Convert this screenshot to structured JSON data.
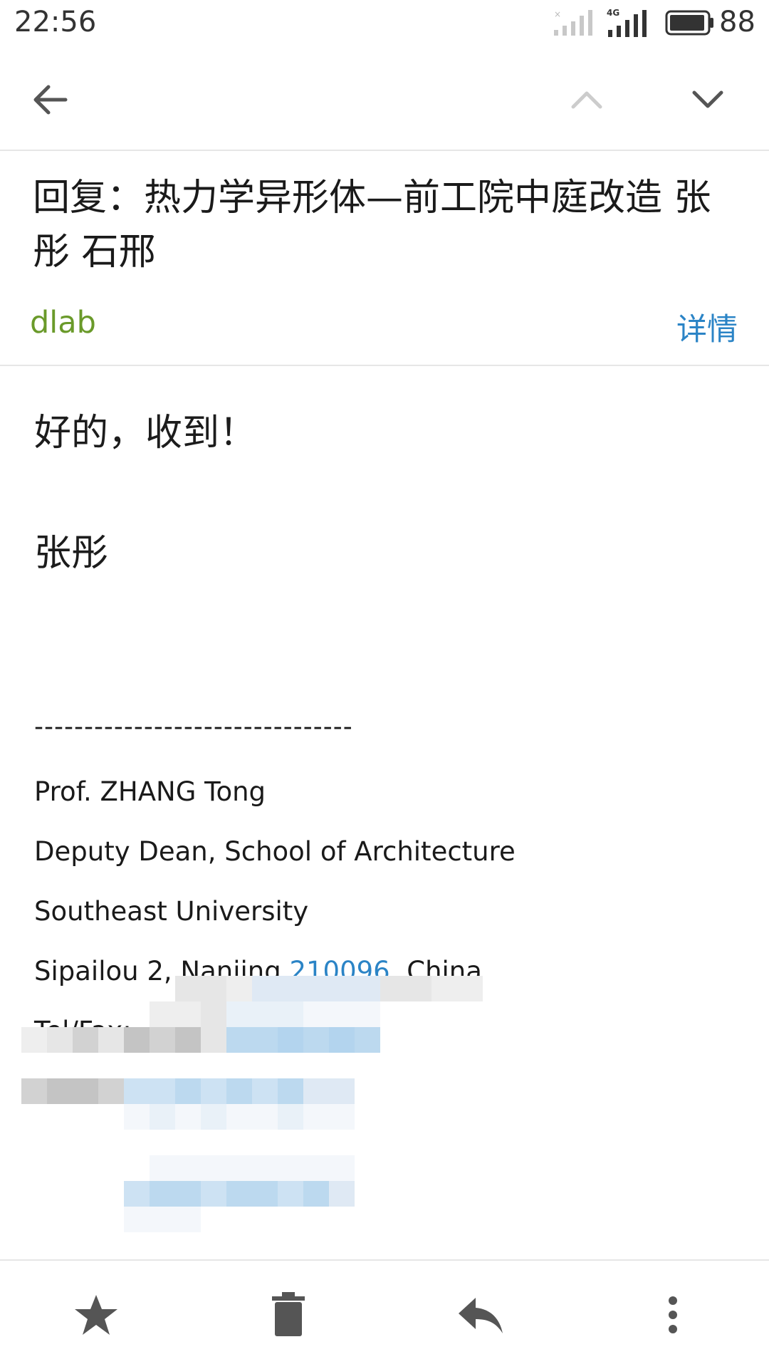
{
  "status_bar": {
    "time": "22:56",
    "battery": "88",
    "network": "4G"
  },
  "toolbar": {
    "back_icon": "arrow-left-icon",
    "prev_icon": "chevron-up-icon",
    "next_icon": "chevron-down-icon"
  },
  "email": {
    "subject": "回复：热力学异形体—前工院中庭改造 张彤 石邢",
    "sender": "dlab",
    "details_link": "详情",
    "body": [
      "好的，收到！",
      "张彤"
    ],
    "signature_rule": "--------------------------------",
    "signature": {
      "name": "Prof. ZHANG Tong",
      "title": "Deputy Dean, School of Architecture",
      "university": "Southeast University",
      "address_prefix": "Sipailou 2, Nanjing ",
      "postcode": "210096",
      "address_suffix": ", China",
      "tel_partial": "Tel/Fax: +8"
    }
  },
  "bottom_bar": {
    "star_icon": "star-icon",
    "delete_icon": "trash-icon",
    "reply_icon": "reply-icon",
    "more_icon": "more-vert-icon"
  },
  "colors": {
    "sender": "#6a9a2a",
    "link": "#2b84c6",
    "divider": "#e6e6e6"
  }
}
